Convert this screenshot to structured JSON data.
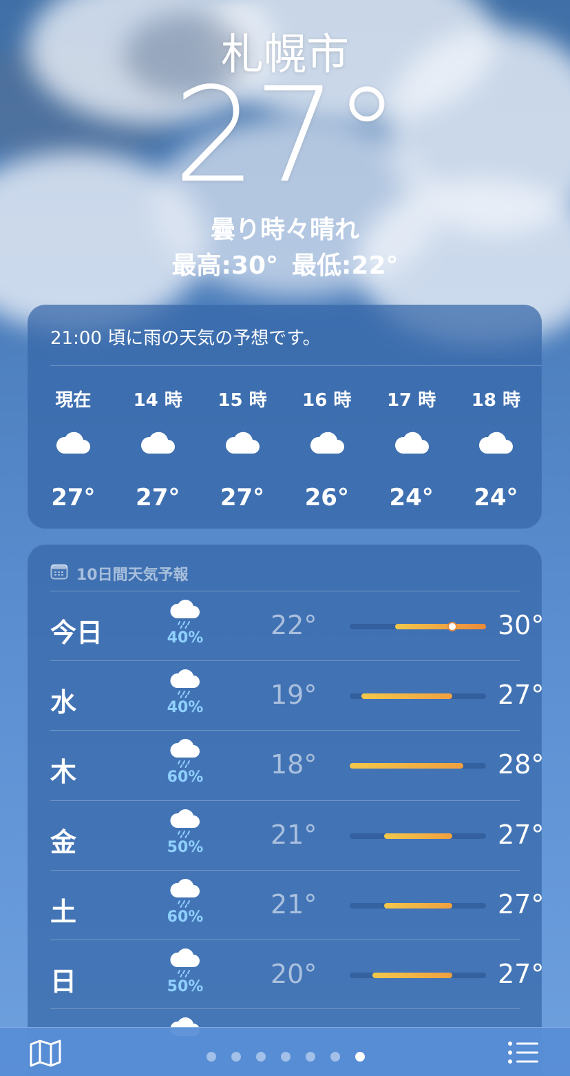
{
  "location": {
    "city": "札幌市",
    "current_temp": "27°",
    "condition": "曇り時々晴れ",
    "high": "最高:30°",
    "low": "最低:22°"
  },
  "hourly": {
    "message": "21:00 頃に雨の天気の予想です。",
    "items": [
      {
        "label": "現在",
        "icon": "cloud-icon",
        "temp": "27°"
      },
      {
        "label": "14 時",
        "icon": "cloud-icon",
        "temp": "27°"
      },
      {
        "label": "15 時",
        "icon": "cloud-icon",
        "temp": "27°"
      },
      {
        "label": "16 時",
        "icon": "cloud-icon",
        "temp": "26°"
      },
      {
        "label": "17 時",
        "icon": "cloud-icon",
        "temp": "24°"
      },
      {
        "label": "18 時",
        "icon": "cloud-icon",
        "temp": "24°"
      }
    ]
  },
  "daily": {
    "title": "10日間天気予報",
    "title_icon": "calendar-icon",
    "days": [
      {
        "day": "今日",
        "icon": "cloud-rain-icon",
        "precip": "40%",
        "low": "22°",
        "high": "30°",
        "range_low": 22,
        "range_high": 30,
        "current": 27
      },
      {
        "day": "水",
        "icon": "cloud-rain-icon",
        "precip": "40%",
        "low": "19°",
        "high": "27°",
        "range_low": 19,
        "range_high": 27
      },
      {
        "day": "木",
        "icon": "cloud-rain-icon",
        "precip": "60%",
        "low": "18°",
        "high": "28°",
        "range_low": 18,
        "range_high": 28
      },
      {
        "day": "金",
        "icon": "cloud-rain-icon",
        "precip": "50%",
        "low": "21°",
        "high": "27°",
        "range_low": 21,
        "range_high": 27
      },
      {
        "day": "土",
        "icon": "cloud-rain-icon",
        "precip": "60%",
        "low": "21°",
        "high": "27°",
        "range_low": 21,
        "range_high": 27
      },
      {
        "day": "日",
        "icon": "cloud-rain-icon",
        "precip": "50%",
        "low": "20°",
        "high": "27°",
        "range_low": 20,
        "range_high": 27
      }
    ],
    "scale_min": 18,
    "scale_max": 30
  },
  "tabbar": {
    "map_icon": "map-icon",
    "list_icon": "list-icon",
    "page_count": 7,
    "active_page": 7
  },
  "colors": {
    "bar_cool": "#f2c84b",
    "bar_warm": "#f0a040",
    "bar_hot": "#ec8a3a",
    "precip": "#8fd0ff"
  }
}
